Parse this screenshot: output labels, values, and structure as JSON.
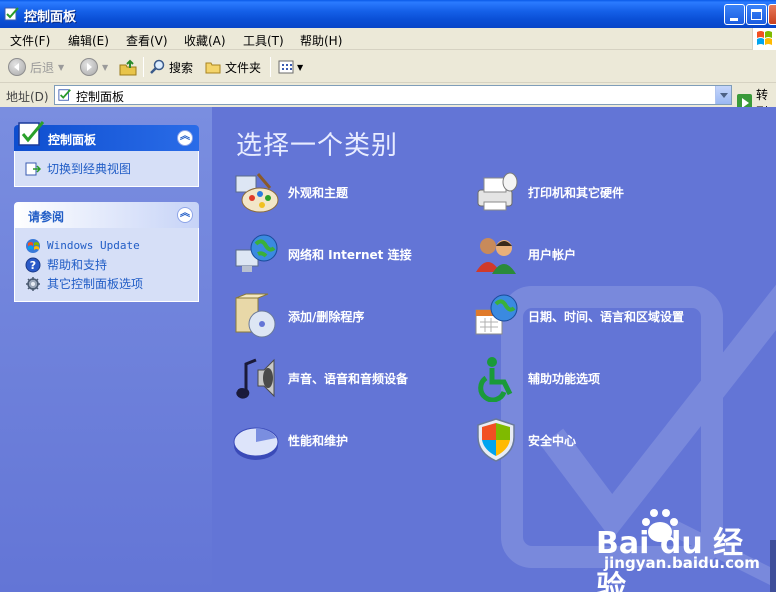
{
  "window": {
    "title": "控制面板"
  },
  "menu": {
    "items": [
      "文件(F)",
      "编辑(E)",
      "查看(V)",
      "收藏(A)",
      "工具(T)",
      "帮助(H)"
    ]
  },
  "toolbar": {
    "back_label": "后退",
    "search_label": "搜索",
    "folders_label": "文件夹"
  },
  "address": {
    "label": "地址(D)",
    "value": "控制面板",
    "go_label": "转到"
  },
  "sidebar": {
    "control_panel": {
      "title": "控制面板",
      "tasks": [
        "切换到经典视图"
      ]
    },
    "see_also": {
      "title": "请参阅",
      "tasks": [
        "Windows Update",
        "帮助和支持",
        "其它控制面板选项"
      ]
    }
  },
  "main": {
    "heading": "选择一个类别",
    "categories": [
      {
        "label": "外观和主题",
        "icon": "appearance-icon"
      },
      {
        "label": "打印机和其它硬件",
        "icon": "printer-icon"
      },
      {
        "label": "网络和 Internet 连接",
        "icon": "network-icon"
      },
      {
        "label": "用户帐户",
        "icon": "users-icon"
      },
      {
        "label": "添加/删除程序",
        "icon": "add-remove-programs-icon"
      },
      {
        "label": "日期、时间、语言和区域设置",
        "icon": "date-time-icon"
      },
      {
        "label": "声音、语音和音频设备",
        "icon": "sound-icon"
      },
      {
        "label": "辅助功能选项",
        "icon": "accessibility-icon"
      },
      {
        "label": "性能和维护",
        "icon": "performance-icon"
      },
      {
        "label": "安全中心",
        "icon": "security-center-icon"
      }
    ]
  },
  "watermark": {
    "brand": "Bai du 经验",
    "url": "jingyan.baidu.com"
  },
  "colors": {
    "sidebar_bg": "#7A8EE0",
    "main_bg": "#6375D6",
    "titlebar": "#0A4FD6",
    "link": "#215DC6"
  }
}
